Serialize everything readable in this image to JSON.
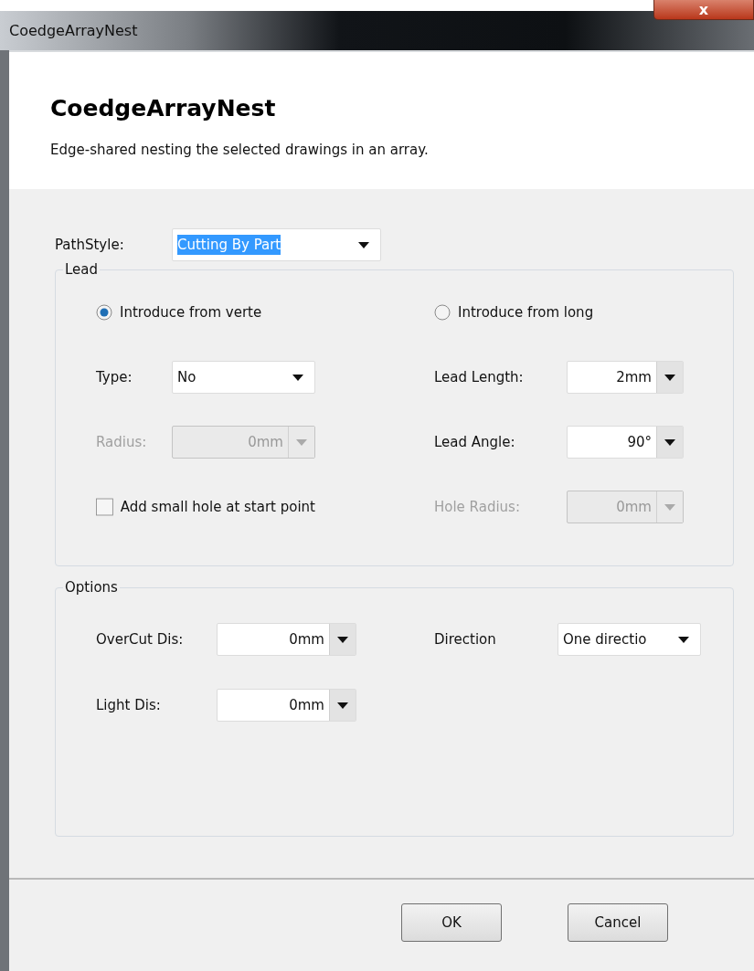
{
  "window": {
    "title": "CoedgeArrayNest",
    "close": "x"
  },
  "header": {
    "title": "CoedgeArrayNest",
    "description": "Edge-shared nesting the selected drawings in an array."
  },
  "path_style": {
    "label": "PathStyle:",
    "value": "Cutting By Part",
    "highlighted": true
  },
  "lead": {
    "title": "Lead",
    "rows": [
      [
        {
          "kind": "radio",
          "label": "Introduce from verte",
          "selected": true
        },
        {
          "kind": "radio",
          "label": "Introduce from long",
          "selected": false
        }
      ],
      [
        {
          "kind": "combo",
          "label": "Type:",
          "value": "No",
          "disabled": false
        },
        {
          "kind": "spin",
          "label": "Lead Length:",
          "value": "2mm",
          "disabled": false
        }
      ],
      [
        {
          "kind": "spin",
          "label": "Radius:",
          "value": "0mm",
          "disabled": true
        },
        {
          "kind": "spin",
          "label": "Lead Angle:",
          "value": "90°",
          "disabled": false
        }
      ],
      [
        {
          "kind": "checkbox",
          "label": "Add small hole at start point",
          "checked": false
        },
        {
          "kind": "spin",
          "label": "Hole Radius:",
          "value": "0mm",
          "disabled": true
        }
      ]
    ]
  },
  "options": {
    "title": "Options",
    "rows": [
      [
        {
          "kind": "spin",
          "label": "OverCut Dis:",
          "value": "0mm",
          "disabled": false
        },
        {
          "kind": "combo",
          "label": "Direction",
          "value": "One directio",
          "disabled": false
        }
      ],
      [
        {
          "kind": "spin",
          "label": "Light Dis:",
          "value": "0mm",
          "disabled": false
        }
      ]
    ]
  },
  "buttons": [
    "OK",
    "Cancel"
  ]
}
